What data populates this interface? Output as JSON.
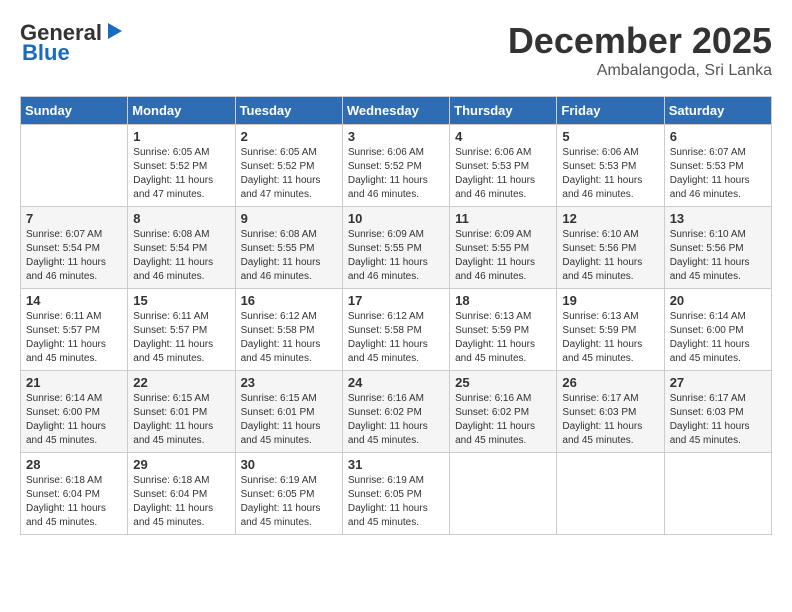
{
  "header": {
    "logo_general": "General",
    "logo_blue": "Blue",
    "month_title": "December 2025",
    "location": "Ambalangoda, Sri Lanka"
  },
  "days_of_week": [
    "Sunday",
    "Monday",
    "Tuesday",
    "Wednesday",
    "Thursday",
    "Friday",
    "Saturday"
  ],
  "weeks": [
    [
      {
        "day": "",
        "sunrise": "",
        "sunset": "",
        "daylight": ""
      },
      {
        "day": "1",
        "sunrise": "Sunrise: 6:05 AM",
        "sunset": "Sunset: 5:52 PM",
        "daylight": "Daylight: 11 hours and 47 minutes."
      },
      {
        "day": "2",
        "sunrise": "Sunrise: 6:05 AM",
        "sunset": "Sunset: 5:52 PM",
        "daylight": "Daylight: 11 hours and 47 minutes."
      },
      {
        "day": "3",
        "sunrise": "Sunrise: 6:06 AM",
        "sunset": "Sunset: 5:52 PM",
        "daylight": "Daylight: 11 hours and 46 minutes."
      },
      {
        "day": "4",
        "sunrise": "Sunrise: 6:06 AM",
        "sunset": "Sunset: 5:53 PM",
        "daylight": "Daylight: 11 hours and 46 minutes."
      },
      {
        "day": "5",
        "sunrise": "Sunrise: 6:06 AM",
        "sunset": "Sunset: 5:53 PM",
        "daylight": "Daylight: 11 hours and 46 minutes."
      },
      {
        "day": "6",
        "sunrise": "Sunrise: 6:07 AM",
        "sunset": "Sunset: 5:53 PM",
        "daylight": "Daylight: 11 hours and 46 minutes."
      }
    ],
    [
      {
        "day": "7",
        "sunrise": "Sunrise: 6:07 AM",
        "sunset": "Sunset: 5:54 PM",
        "daylight": "Daylight: 11 hours and 46 minutes."
      },
      {
        "day": "8",
        "sunrise": "Sunrise: 6:08 AM",
        "sunset": "Sunset: 5:54 PM",
        "daylight": "Daylight: 11 hours and 46 minutes."
      },
      {
        "day": "9",
        "sunrise": "Sunrise: 6:08 AM",
        "sunset": "Sunset: 5:55 PM",
        "daylight": "Daylight: 11 hours and 46 minutes."
      },
      {
        "day": "10",
        "sunrise": "Sunrise: 6:09 AM",
        "sunset": "Sunset: 5:55 PM",
        "daylight": "Daylight: 11 hours and 46 minutes."
      },
      {
        "day": "11",
        "sunrise": "Sunrise: 6:09 AM",
        "sunset": "Sunset: 5:55 PM",
        "daylight": "Daylight: 11 hours and 46 minutes."
      },
      {
        "day": "12",
        "sunrise": "Sunrise: 6:10 AM",
        "sunset": "Sunset: 5:56 PM",
        "daylight": "Daylight: 11 hours and 45 minutes."
      },
      {
        "day": "13",
        "sunrise": "Sunrise: 6:10 AM",
        "sunset": "Sunset: 5:56 PM",
        "daylight": "Daylight: 11 hours and 45 minutes."
      }
    ],
    [
      {
        "day": "14",
        "sunrise": "Sunrise: 6:11 AM",
        "sunset": "Sunset: 5:57 PM",
        "daylight": "Daylight: 11 hours and 45 minutes."
      },
      {
        "day": "15",
        "sunrise": "Sunrise: 6:11 AM",
        "sunset": "Sunset: 5:57 PM",
        "daylight": "Daylight: 11 hours and 45 minutes."
      },
      {
        "day": "16",
        "sunrise": "Sunrise: 6:12 AM",
        "sunset": "Sunset: 5:58 PM",
        "daylight": "Daylight: 11 hours and 45 minutes."
      },
      {
        "day": "17",
        "sunrise": "Sunrise: 6:12 AM",
        "sunset": "Sunset: 5:58 PM",
        "daylight": "Daylight: 11 hours and 45 minutes."
      },
      {
        "day": "18",
        "sunrise": "Sunrise: 6:13 AM",
        "sunset": "Sunset: 5:59 PM",
        "daylight": "Daylight: 11 hours and 45 minutes."
      },
      {
        "day": "19",
        "sunrise": "Sunrise: 6:13 AM",
        "sunset": "Sunset: 5:59 PM",
        "daylight": "Daylight: 11 hours and 45 minutes."
      },
      {
        "day": "20",
        "sunrise": "Sunrise: 6:14 AM",
        "sunset": "Sunset: 6:00 PM",
        "daylight": "Daylight: 11 hours and 45 minutes."
      }
    ],
    [
      {
        "day": "21",
        "sunrise": "Sunrise: 6:14 AM",
        "sunset": "Sunset: 6:00 PM",
        "daylight": "Daylight: 11 hours and 45 minutes."
      },
      {
        "day": "22",
        "sunrise": "Sunrise: 6:15 AM",
        "sunset": "Sunset: 6:01 PM",
        "daylight": "Daylight: 11 hours and 45 minutes."
      },
      {
        "day": "23",
        "sunrise": "Sunrise: 6:15 AM",
        "sunset": "Sunset: 6:01 PM",
        "daylight": "Daylight: 11 hours and 45 minutes."
      },
      {
        "day": "24",
        "sunrise": "Sunrise: 6:16 AM",
        "sunset": "Sunset: 6:02 PM",
        "daylight": "Daylight: 11 hours and 45 minutes."
      },
      {
        "day": "25",
        "sunrise": "Sunrise: 6:16 AM",
        "sunset": "Sunset: 6:02 PM",
        "daylight": "Daylight: 11 hours and 45 minutes."
      },
      {
        "day": "26",
        "sunrise": "Sunrise: 6:17 AM",
        "sunset": "Sunset: 6:03 PM",
        "daylight": "Daylight: 11 hours and 45 minutes."
      },
      {
        "day": "27",
        "sunrise": "Sunrise: 6:17 AM",
        "sunset": "Sunset: 6:03 PM",
        "daylight": "Daylight: 11 hours and 45 minutes."
      }
    ],
    [
      {
        "day": "28",
        "sunrise": "Sunrise: 6:18 AM",
        "sunset": "Sunset: 6:04 PM",
        "daylight": "Daylight: 11 hours and 45 minutes."
      },
      {
        "day": "29",
        "sunrise": "Sunrise: 6:18 AM",
        "sunset": "Sunset: 6:04 PM",
        "daylight": "Daylight: 11 hours and 45 minutes."
      },
      {
        "day": "30",
        "sunrise": "Sunrise: 6:19 AM",
        "sunset": "Sunset: 6:05 PM",
        "daylight": "Daylight: 11 hours and 45 minutes."
      },
      {
        "day": "31",
        "sunrise": "Sunrise: 6:19 AM",
        "sunset": "Sunset: 6:05 PM",
        "daylight": "Daylight: 11 hours and 45 minutes."
      },
      {
        "day": "",
        "sunrise": "",
        "sunset": "",
        "daylight": ""
      },
      {
        "day": "",
        "sunrise": "",
        "sunset": "",
        "daylight": ""
      },
      {
        "day": "",
        "sunrise": "",
        "sunset": "",
        "daylight": ""
      }
    ]
  ]
}
